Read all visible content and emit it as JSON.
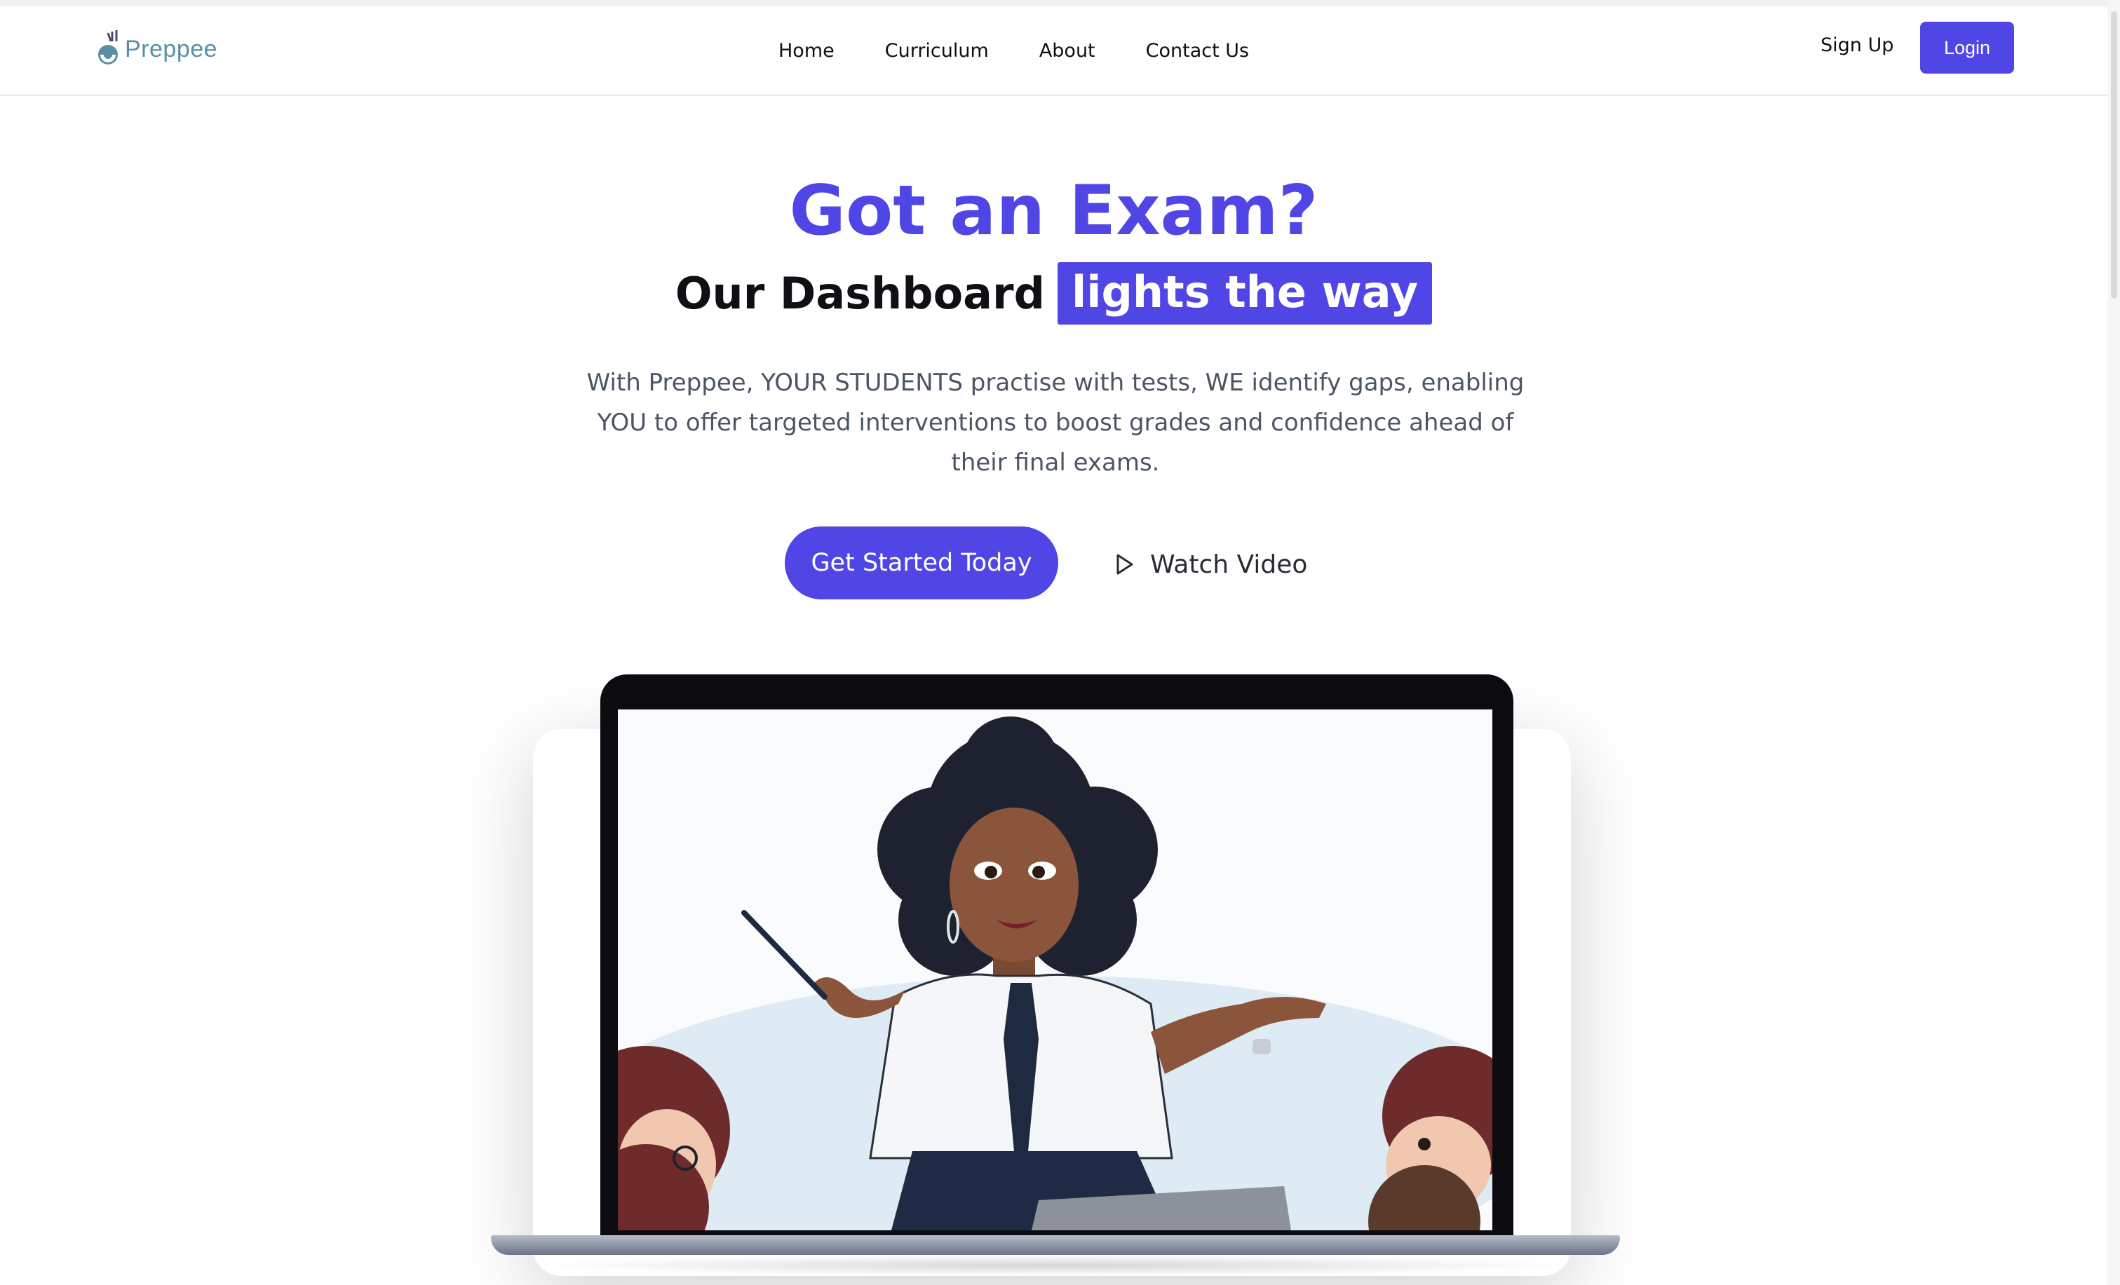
{
  "brand": {
    "name": "Preppee",
    "color": "#5a8ea6"
  },
  "nav": {
    "links": [
      {
        "label": "Home"
      },
      {
        "label": "Curriculum"
      },
      {
        "label": "About"
      },
      {
        "label": "Contact Us"
      }
    ],
    "signup_label": "Sign Up",
    "login_label": "Login"
  },
  "hero": {
    "title": "Got an Exam?",
    "subtitle_prefix": "Our Dashboard",
    "subtitle_highlight": "lights the way",
    "description": "With Preppee, YOUR STUDENTS practise with tests, WE identify gaps, enabling YOU to offer targeted interventions to boost grades and confidence ahead of their final exams.",
    "cta_label": "Get Started Today",
    "watch_label": "Watch Video"
  },
  "illustration": {
    "subject": "teacher-with-students-illustration"
  },
  "colors": {
    "accent": "#4f46e5",
    "text": "#0f0f14",
    "muted": "#4b5563"
  }
}
